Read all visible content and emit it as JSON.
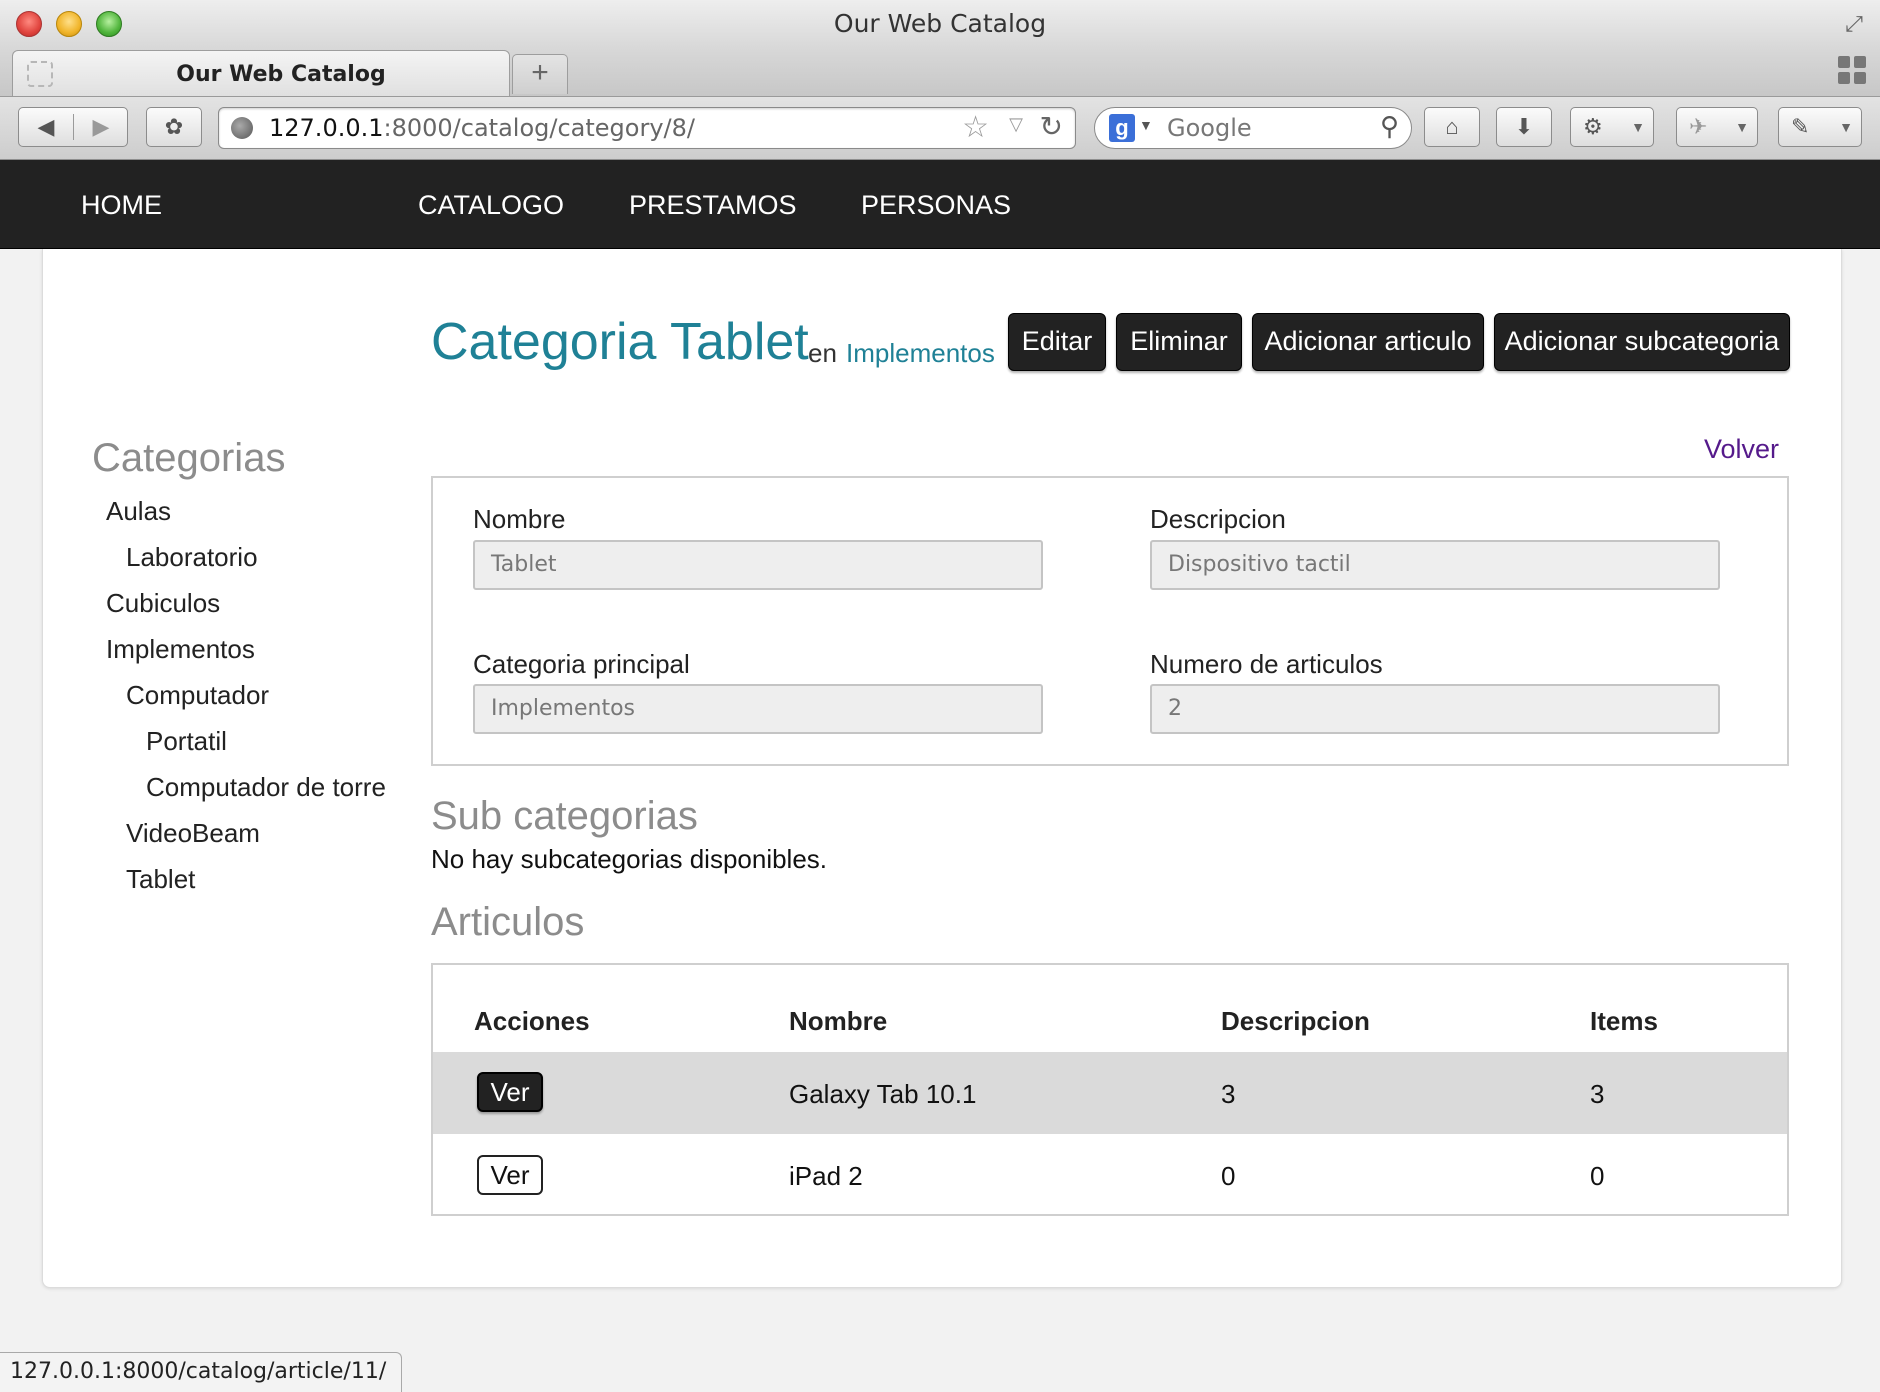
{
  "browser": {
    "window_title": "Our Web Catalog",
    "tab_title": "Our Web Catalog",
    "new_tab_label": "+",
    "url_host": "127.0.0.1",
    "url_path": ":8000/catalog/category/8/",
    "search_placeholder": "Google",
    "status_url": "127.0.0.1:8000/catalog/article/11/"
  },
  "nav": {
    "home": "HOME",
    "catalogo": "CATALOGO",
    "prestamos": "PRESTAMOS",
    "personas": "PERSONAS"
  },
  "page": {
    "title": "Categoria Tablet",
    "title_in": "en",
    "parent_link": "Implementos",
    "buttons": {
      "edit": "Editar",
      "delete": "Eliminar",
      "add_article": "Adicionar articulo",
      "add_subcategory": "Adicionar subcategoria"
    },
    "back_link": "Volver"
  },
  "sidebar": {
    "heading": "Categorias",
    "items": [
      {
        "label": "Aulas",
        "level": 0
      },
      {
        "label": "Laboratorio",
        "level": 1
      },
      {
        "label": "Cubiculos",
        "level": 0
      },
      {
        "label": "Implementos",
        "level": 0
      },
      {
        "label": "Computador",
        "level": 1
      },
      {
        "label": "Portatil",
        "level": 2
      },
      {
        "label": "Computador de torre",
        "level": 2
      },
      {
        "label": "VideoBeam",
        "level": 1
      },
      {
        "label": "Tablet",
        "level": 1
      }
    ]
  },
  "form": {
    "nombre_label": "Nombre",
    "nombre_value": "Tablet",
    "descripcion_label": "Descripcion",
    "descripcion_value": "Dispositivo tactil",
    "categoria_label": "Categoria principal",
    "categoria_value": "Implementos",
    "numero_label": "Numero de articulos",
    "numero_value": "2"
  },
  "subcategories": {
    "heading": "Sub categorias",
    "empty_message": "No hay subcategorias disponibles."
  },
  "articles": {
    "heading": "Articulos",
    "columns": [
      "Acciones",
      "Nombre",
      "Descripcion",
      "Items"
    ],
    "rows": [
      {
        "action": "Ver",
        "nombre": "Galaxy Tab 10.1",
        "descripcion": "3",
        "items": "3"
      },
      {
        "action": "Ver",
        "nombre": "iPad 2",
        "descripcion": "0",
        "items": "0"
      }
    ]
  },
  "colors": {
    "accent": "#1f8196",
    "nav_bg": "#222222",
    "visited_link": "#551a8b"
  }
}
